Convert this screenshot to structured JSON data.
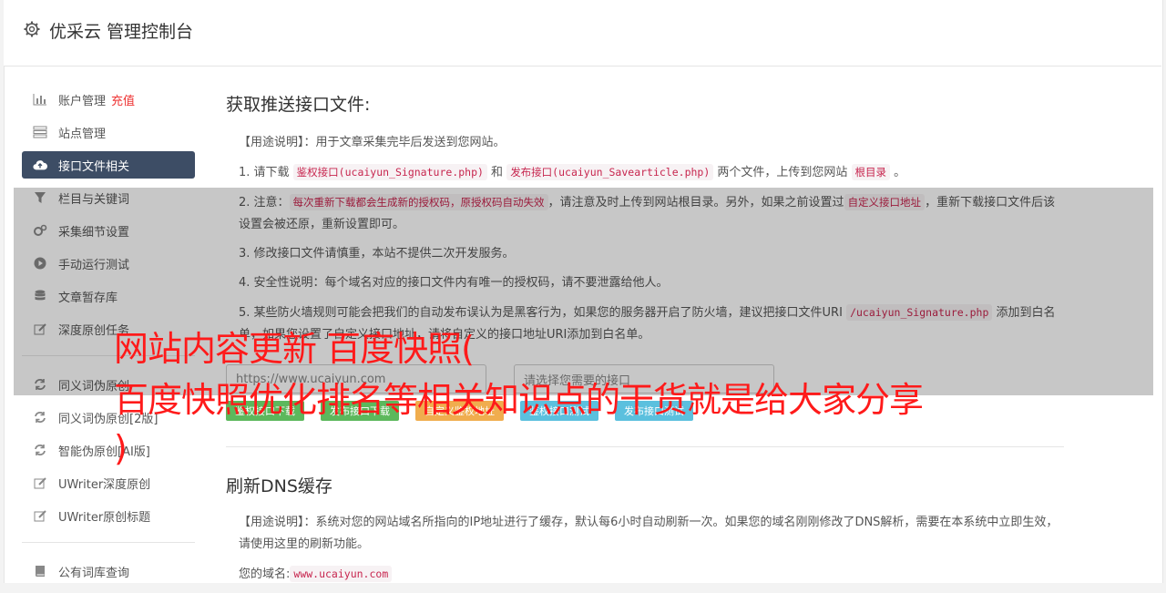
{
  "header": {
    "title": "优采云 管理控制台"
  },
  "sidebar": {
    "items": [
      {
        "label": "账户管理",
        "extra": "充值",
        "icon": "bar-chart-icon"
      },
      {
        "label": "站点管理",
        "icon": "server-icon"
      },
      {
        "label": "接口文件相关",
        "icon": "cloud-upload-icon",
        "active": true
      },
      {
        "label": "栏目与关键词",
        "icon": "filter-icon"
      },
      {
        "label": "采集细节设置",
        "icon": "cogs-icon"
      },
      {
        "label": "手动运行测试",
        "icon": "play-circle-icon"
      },
      {
        "label": "文章暂存库",
        "icon": "database-icon"
      },
      {
        "label": "深度原创任务",
        "icon": "edit-icon"
      },
      {
        "label": "同义词伪原创",
        "icon": "refresh-icon"
      },
      {
        "label": "同义词伪原创[2版]",
        "icon": "refresh-icon"
      },
      {
        "label": "智能伪原创[AI版]",
        "icon": "refresh-icon"
      },
      {
        "label": "UWriter深度原创",
        "icon": "edit-icon"
      },
      {
        "label": "UWriter原创标题",
        "icon": "edit-icon"
      },
      {
        "label": "公有词库查询",
        "icon": "book-icon"
      }
    ]
  },
  "main": {
    "section1": {
      "title": "获取推送接口文件:",
      "usage": "【用途说明】：用于文章采集完毕后发送到您网站。",
      "p1": {
        "a": "1. 请下载 ",
        "c1": "鉴权接口(ucaiyun_Signature.php)",
        "b": " 和 ",
        "c2": "发布接口(ucaiyun_Savearticle.php)",
        "d": " 两个文件，上传到您网站 ",
        "c3": "根目录",
        "e": " 。"
      },
      "p2": {
        "a": "2. 注意：",
        "c1": "每次重新下载都会生成新的授权码，原授权码自动失效",
        "b": "，请注意及时上传到网站根目录。另外，如果之前设置过",
        "c2": "自定义接口地址",
        "d": "，重新下载接口文件后该设置会被还原，重新设置即可。"
      },
      "p3": "3. 修改接口文件请慎重，本站不提供二次开发服务。",
      "p4": "4. 安全性说明：每个域名对应的接口文件内有唯一的授权码，请不要泄露给他人。",
      "p5": {
        "a": "5. 某些防火墙规则可能会把我们的自动发布误认为是黑客行为，如果您的服务器开启了防火墙，建议把接口文件URI ",
        "c1": "/ucaiyun_Signature.php",
        "b": " 添加到白名单，如果您设置了自定义接口地址，请将自定义的接口地址URI添加到白名单。"
      },
      "url_placeholder": "https://www.ucaiyun.com",
      "select_placeholder": "请选择您需要的接口",
      "buttons": [
        "鉴权接口下载",
        "发布接口下载",
        "自定义鉴权地址",
        "鉴权接口测试",
        "发布接口测试"
      ]
    },
    "section2": {
      "title": "刷新DNS缓存",
      "usage": "【用途说明】：系统对您的网站域名所指向的IP地址进行了缓存，默认每6小时自动刷新一次。如果您的域名刚刚修改了DNS解析，需要在本系统中立即生效，请使用这里的刷新功能。",
      "domain_label": "您的域名:",
      "domain_value": "www.ucaiyun.com"
    }
  },
  "watermark": {
    "line1": "网站内容更新 百度快照(",
    "line2": "百度快照优化排名等相关知识点的干货就是给大家分享",
    "line3": ")"
  },
  "colors": {
    "active_nav": "#3d4d65",
    "code_text": "#c7254e",
    "accent_red": "#ff1a1a",
    "btn_green": "#5cb85c",
    "btn_orange": "#f0ad4e",
    "btn_blue": "#5bc0de"
  }
}
